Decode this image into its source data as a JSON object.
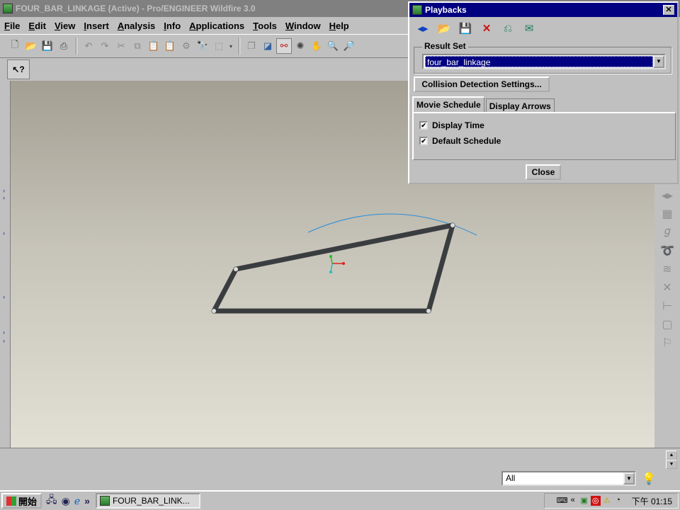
{
  "window": {
    "title": "FOUR_BAR_LINKAGE (Active) - Pro/ENGINEER Wildfire 3.0"
  },
  "menu": [
    "File",
    "Edit",
    "View",
    "Insert",
    "Analysis",
    "Info",
    "Applications",
    "Tools",
    "Window",
    "Help"
  ],
  "dialog": {
    "title": "Playbacks",
    "result_set_label": "Result Set",
    "result_set_value": "four_bar_linkage",
    "collision_button": "Collision Detection Settings...",
    "tabs": [
      "Movie Schedule",
      "Display Arrows"
    ],
    "checkboxes": [
      {
        "label": "Display Time",
        "checked": true
      },
      {
        "label": "Default Schedule",
        "checked": true
      }
    ],
    "close_button": "Close"
  },
  "filter": {
    "value": "All"
  },
  "taskbar": {
    "start_label": "開始",
    "task_label": "FOUR_BAR_LINK...",
    "clock": "下午 01:15"
  },
  "colors": {
    "title_active": "#000080",
    "title_inactive": "#808080",
    "link_bar": "#3a3d40",
    "path_curve": "#2a8fd8"
  }
}
